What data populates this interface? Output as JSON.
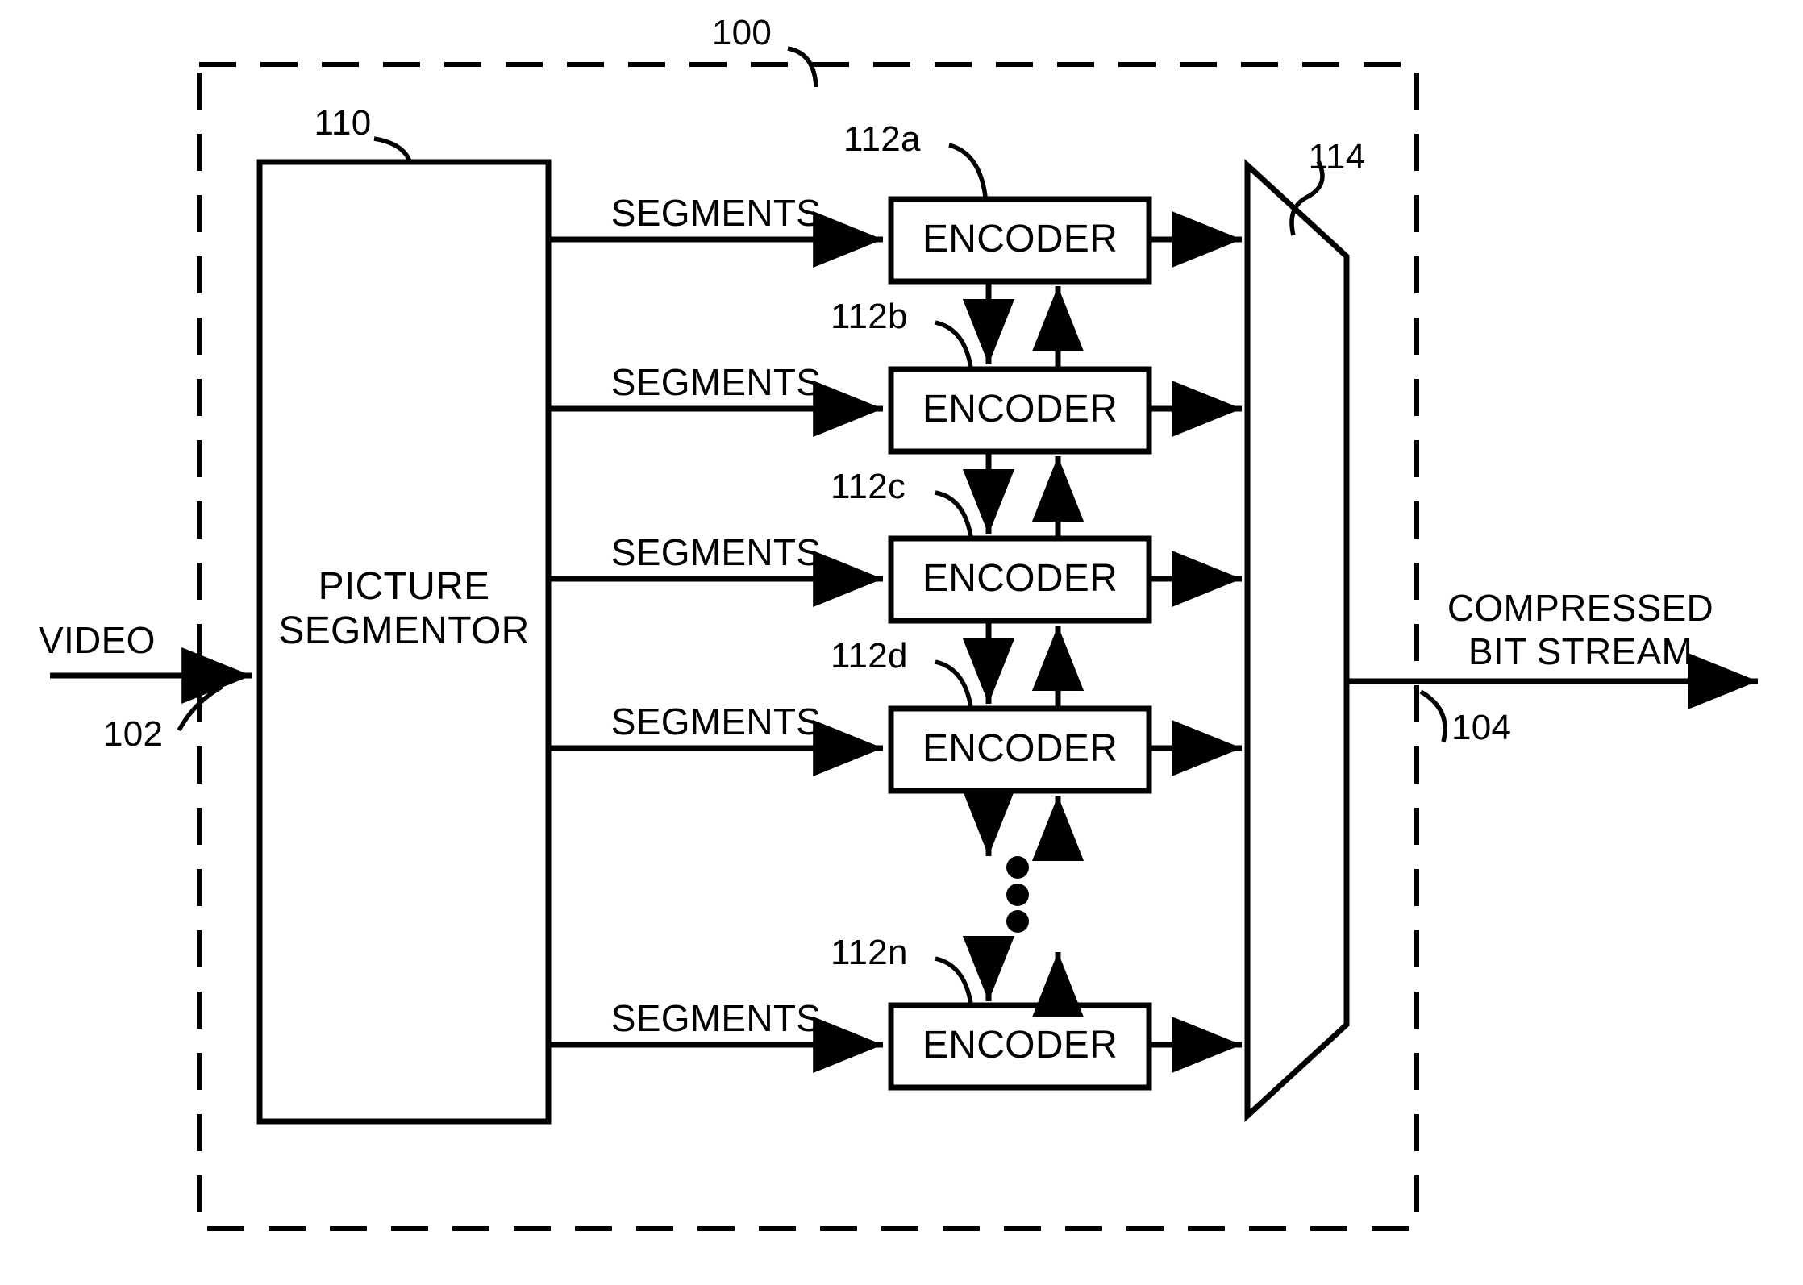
{
  "figure": {
    "type": "patent-block-diagram",
    "subject": "parallel video encoder system",
    "line_color": "#000000",
    "background_color": "#ffffff",
    "system_boundary": {
      "ref": "100",
      "style": "dashed"
    }
  },
  "inputs": [
    {
      "name": "video-input",
      "label": "VIDEO",
      "ref": "102"
    }
  ],
  "outputs": [
    {
      "name": "compressed-bitstream-output",
      "label_line1": "COMPRESSED",
      "label_line2": "BIT STREAM",
      "ref": "104"
    }
  ],
  "blocks": {
    "segmentor": {
      "ref": "110",
      "label_line1": "PICTURE",
      "label_line2": "SEGMENTOR"
    },
    "multiplexer": {
      "ref": "114",
      "label": ""
    },
    "encoders": [
      {
        "ref": "112a",
        "label": "ENCODER",
        "segments_label": "SEGMENTS"
      },
      {
        "ref": "112b",
        "label": "ENCODER",
        "segments_label": "SEGMENTS"
      },
      {
        "ref": "112c",
        "label": "ENCODER",
        "segments_label": "SEGMENTS"
      },
      {
        "ref": "112d",
        "label": "ENCODER",
        "segments_label": "SEGMENTS"
      },
      {
        "ref": "112n",
        "label": "ENCODER",
        "segments_label": "SEGMENTS"
      }
    ]
  },
  "ellipsis": {
    "name": "vertical-ellipsis",
    "dots": 3
  }
}
